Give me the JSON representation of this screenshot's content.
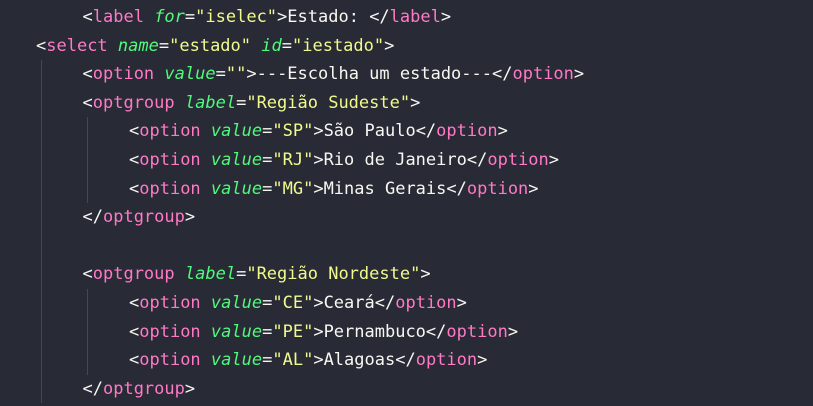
{
  "editor": {
    "theme_colors": {
      "background": "#282a36",
      "punctuation": "#f8f8f2",
      "tag": "#ff79c6",
      "attribute": "#50fa7b",
      "string": "#f1fa8c",
      "text": "#f8f8f2",
      "indent_guide": "#44475a"
    },
    "lines": [
      {
        "indent": 1,
        "tokens": [
          {
            "t": "punct",
            "v": "<"
          },
          {
            "t": "tag",
            "v": "label"
          },
          {
            "t": "space",
            "v": " "
          },
          {
            "t": "attr",
            "v": "for"
          },
          {
            "t": "punct",
            "v": "="
          },
          {
            "t": "str",
            "v": "\"iselec\""
          },
          {
            "t": "punct",
            "v": ">"
          },
          {
            "t": "text",
            "v": "Estado: "
          },
          {
            "t": "punct",
            "v": "</"
          },
          {
            "t": "tag",
            "v": "label"
          },
          {
            "t": "punct",
            "v": ">"
          }
        ]
      },
      {
        "indent": 0,
        "tokens": [
          {
            "t": "punct",
            "v": "<"
          },
          {
            "t": "tag",
            "v": "select"
          },
          {
            "t": "space",
            "v": " "
          },
          {
            "t": "attr",
            "v": "name"
          },
          {
            "t": "punct",
            "v": "="
          },
          {
            "t": "str",
            "v": "\"estado\""
          },
          {
            "t": "space",
            "v": " "
          },
          {
            "t": "attr",
            "v": "id"
          },
          {
            "t": "punct",
            "v": "="
          },
          {
            "t": "str",
            "v": "\"iestado\""
          },
          {
            "t": "punct",
            "v": ">"
          }
        ]
      },
      {
        "indent": 1,
        "tokens": [
          {
            "t": "punct",
            "v": "<"
          },
          {
            "t": "tag",
            "v": "option"
          },
          {
            "t": "space",
            "v": " "
          },
          {
            "t": "attr",
            "v": "value"
          },
          {
            "t": "punct",
            "v": "="
          },
          {
            "t": "str",
            "v": "\"\""
          },
          {
            "t": "punct",
            "v": ">"
          },
          {
            "t": "text",
            "v": "---Escolha um estado---"
          },
          {
            "t": "punct",
            "v": "</"
          },
          {
            "t": "tag",
            "v": "option"
          },
          {
            "t": "punct",
            "v": ">"
          }
        ]
      },
      {
        "indent": 1,
        "tokens": [
          {
            "t": "punct",
            "v": "<"
          },
          {
            "t": "tag",
            "v": "optgroup"
          },
          {
            "t": "space",
            "v": " "
          },
          {
            "t": "attr",
            "v": "label"
          },
          {
            "t": "punct",
            "v": "="
          },
          {
            "t": "str",
            "v": "\"Região Sudeste\""
          },
          {
            "t": "punct",
            "v": ">"
          }
        ]
      },
      {
        "indent": 2,
        "tokens": [
          {
            "t": "punct",
            "v": "<"
          },
          {
            "t": "tag",
            "v": "option"
          },
          {
            "t": "space",
            "v": " "
          },
          {
            "t": "attr",
            "v": "value"
          },
          {
            "t": "punct",
            "v": "="
          },
          {
            "t": "str",
            "v": "\"SP\""
          },
          {
            "t": "punct",
            "v": ">"
          },
          {
            "t": "text",
            "v": "São Paulo"
          },
          {
            "t": "punct",
            "v": "</"
          },
          {
            "t": "tag",
            "v": "option"
          },
          {
            "t": "punct",
            "v": ">"
          }
        ]
      },
      {
        "indent": 2,
        "tokens": [
          {
            "t": "punct",
            "v": "<"
          },
          {
            "t": "tag",
            "v": "option"
          },
          {
            "t": "space",
            "v": " "
          },
          {
            "t": "attr",
            "v": "value"
          },
          {
            "t": "punct",
            "v": "="
          },
          {
            "t": "str",
            "v": "\"RJ\""
          },
          {
            "t": "punct",
            "v": ">"
          },
          {
            "t": "text",
            "v": "Rio de Janeiro"
          },
          {
            "t": "punct",
            "v": "</"
          },
          {
            "t": "tag",
            "v": "option"
          },
          {
            "t": "punct",
            "v": ">"
          }
        ]
      },
      {
        "indent": 2,
        "tokens": [
          {
            "t": "punct",
            "v": "<"
          },
          {
            "t": "tag",
            "v": "option"
          },
          {
            "t": "space",
            "v": " "
          },
          {
            "t": "attr",
            "v": "value"
          },
          {
            "t": "punct",
            "v": "="
          },
          {
            "t": "str",
            "v": "\"MG\""
          },
          {
            "t": "punct",
            "v": ">"
          },
          {
            "t": "text",
            "v": "Minas Gerais"
          },
          {
            "t": "punct",
            "v": "</"
          },
          {
            "t": "tag",
            "v": "option"
          },
          {
            "t": "punct",
            "v": ">"
          }
        ]
      },
      {
        "indent": 1,
        "tokens": [
          {
            "t": "punct",
            "v": "</"
          },
          {
            "t": "tag",
            "v": "optgroup"
          },
          {
            "t": "punct",
            "v": ">"
          }
        ]
      },
      {
        "indent": 0,
        "tokens": []
      },
      {
        "indent": 1,
        "tokens": [
          {
            "t": "punct",
            "v": "<"
          },
          {
            "t": "tag",
            "v": "optgroup"
          },
          {
            "t": "space",
            "v": " "
          },
          {
            "t": "attr",
            "v": "label"
          },
          {
            "t": "punct",
            "v": "="
          },
          {
            "t": "str",
            "v": "\"Região Nordeste\""
          },
          {
            "t": "punct",
            "v": ">"
          }
        ]
      },
      {
        "indent": 2,
        "tokens": [
          {
            "t": "punct",
            "v": "<"
          },
          {
            "t": "tag",
            "v": "option"
          },
          {
            "t": "space",
            "v": " "
          },
          {
            "t": "attr",
            "v": "value"
          },
          {
            "t": "punct",
            "v": "="
          },
          {
            "t": "str",
            "v": "\"CE\""
          },
          {
            "t": "punct",
            "v": ">"
          },
          {
            "t": "text",
            "v": "Ceará"
          },
          {
            "t": "punct",
            "v": "</"
          },
          {
            "t": "tag",
            "v": "option"
          },
          {
            "t": "punct",
            "v": ">"
          }
        ]
      },
      {
        "indent": 2,
        "tokens": [
          {
            "t": "punct",
            "v": "<"
          },
          {
            "t": "tag",
            "v": "option"
          },
          {
            "t": "space",
            "v": " "
          },
          {
            "t": "attr",
            "v": "value"
          },
          {
            "t": "punct",
            "v": "="
          },
          {
            "t": "str",
            "v": "\"PE\""
          },
          {
            "t": "punct",
            "v": ">"
          },
          {
            "t": "text",
            "v": "Pernambuco"
          },
          {
            "t": "punct",
            "v": "</"
          },
          {
            "t": "tag",
            "v": "option"
          },
          {
            "t": "punct",
            "v": ">"
          }
        ]
      },
      {
        "indent": 2,
        "tokens": [
          {
            "t": "punct",
            "v": "<"
          },
          {
            "t": "tag",
            "v": "option"
          },
          {
            "t": "space",
            "v": " "
          },
          {
            "t": "attr",
            "v": "value"
          },
          {
            "t": "punct",
            "v": "="
          },
          {
            "t": "str",
            "v": "\"AL\""
          },
          {
            "t": "punct",
            "v": ">"
          },
          {
            "t": "text",
            "v": "Alagoas"
          },
          {
            "t": "punct",
            "v": "</"
          },
          {
            "t": "tag",
            "v": "option"
          },
          {
            "t": "punct",
            "v": ">"
          }
        ]
      },
      {
        "indent": 1,
        "tokens": [
          {
            "t": "punct",
            "v": "</"
          },
          {
            "t": "tag",
            "v": "optgroup"
          },
          {
            "t": "punct",
            "v": ">"
          }
        ]
      }
    ]
  }
}
